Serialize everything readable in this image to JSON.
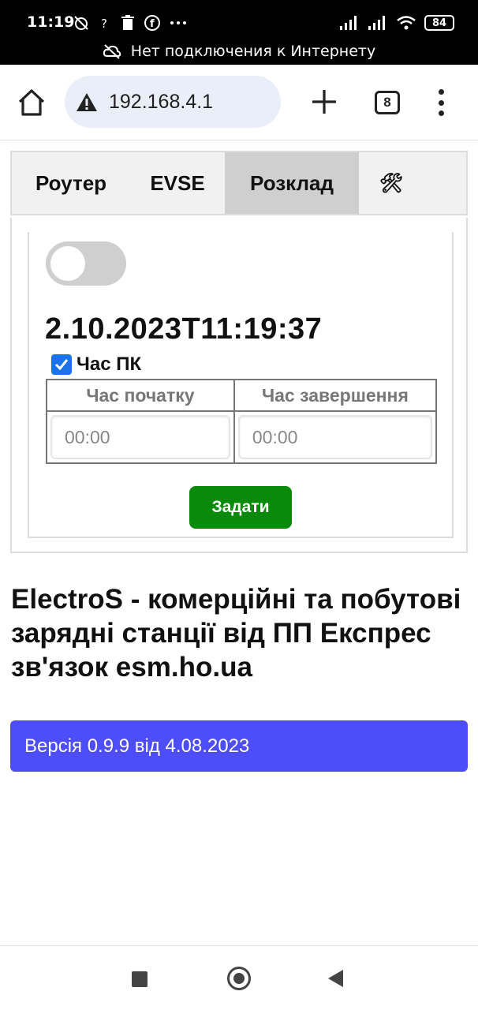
{
  "status_bar": {
    "time": "11:19",
    "battery": "84",
    "offline_message": "Нет подключения к Интернету"
  },
  "browser": {
    "url": "192.168.4.1",
    "tab_count": "8"
  },
  "tabs": [
    {
      "label": "Роутер"
    },
    {
      "label": "EVSE"
    },
    {
      "label": "Розклад"
    },
    {
      "label": "🛠"
    }
  ],
  "schedule": {
    "datetime": "2.10.2023T11:19:37",
    "pc_time_label": "Час ПК",
    "start_header": "Час початку",
    "end_header": "Час завершення",
    "start_value": "00:00",
    "end_value": "00:00",
    "submit_label": "Задати"
  },
  "heading": "ElectroS - комерційні та побутові зарядні станції від ПП Експрес зв'язок esm.ho.ua",
  "version": "Версія 0.9.9 від 4.08.2023",
  "colors": {
    "active_tab": "#cfcfcf",
    "submit_button": "#0a8a0a",
    "version_bar": "#4d4dfa",
    "checkbox": "#1a73e8"
  }
}
